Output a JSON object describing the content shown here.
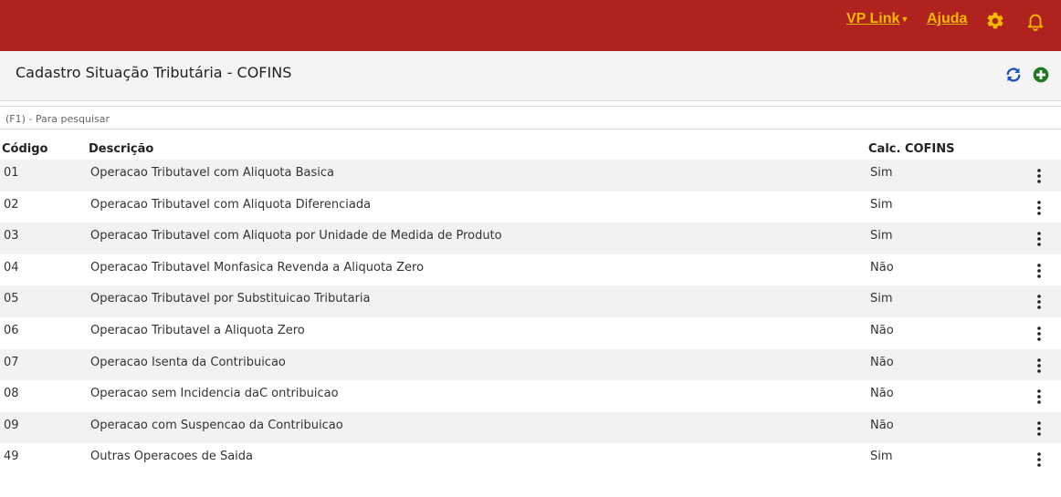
{
  "topbar": {
    "vplink_label": "VP Link",
    "ajuda_label": "Ajuda",
    "accent_color": "#f5b800",
    "bar_color": "#b0221e"
  },
  "header": {
    "title": "Cadastro Situação Tributária - COFINS"
  },
  "search": {
    "placeholder": "(F1) - Para pesquisar"
  },
  "columns": {
    "code": "Código",
    "description": "Descrição",
    "calc": "Calc. COFINS"
  },
  "rows": [
    {
      "code": "01",
      "description": "Operacao Tributavel com Aliquota Basica",
      "calc": "Sim"
    },
    {
      "code": "02",
      "description": "Operacao Tributavel com Aliquota Diferenciada",
      "calc": "Sim"
    },
    {
      "code": "03",
      "description": "Operacao Tributavel com Aliquota por Unidade de Medida de Produto",
      "calc": "Sim"
    },
    {
      "code": "04",
      "description": "Operacao Tributavel Monfasica Revenda a Aliquota Zero",
      "calc": "Não"
    },
    {
      "code": "05",
      "description": "Operacao Tributavel por Substituicao Tributaria",
      "calc": "Sim"
    },
    {
      "code": "06",
      "description": "Operacao Tributavel a Aliquota Zero",
      "calc": "Não"
    },
    {
      "code": "07",
      "description": "Operacao Isenta da Contribuicao",
      "calc": "Não"
    },
    {
      "code": "08",
      "description": "Operacao sem Incidencia daC ontribuicao",
      "calc": "Não"
    },
    {
      "code": "09",
      "description": "Operacao com Suspencao da Contribuicao",
      "calc": "Não"
    },
    {
      "code": "49",
      "description": "Outras Operacoes de Saida",
      "calc": "Sim"
    }
  ],
  "icons": {
    "gear": "gear-icon",
    "bell": "bell-icon",
    "refresh": "refresh-icon",
    "add": "add-circle-icon",
    "row_menu": "kebab-menu-icon"
  }
}
